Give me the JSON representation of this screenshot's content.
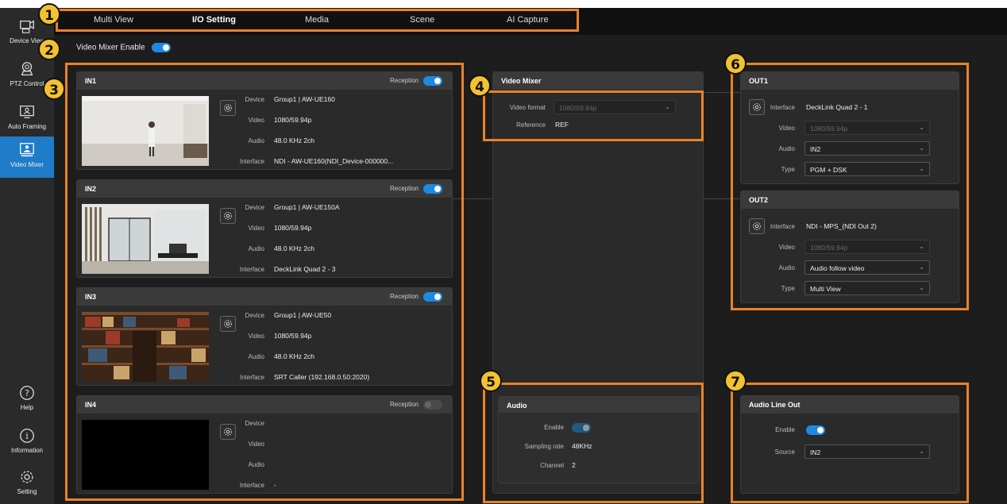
{
  "tabs": [
    {
      "label": "Multi View",
      "active": false
    },
    {
      "label": "I/O Setting",
      "active": true
    },
    {
      "label": "Media",
      "active": false
    },
    {
      "label": "Scene",
      "active": false
    },
    {
      "label": "AI Capture",
      "active": false
    }
  ],
  "sidebar": {
    "items": [
      {
        "label": "Device View",
        "icon": "device-view-icon",
        "active": false
      },
      {
        "label": "PTZ Control",
        "icon": "camera-icon",
        "active": false
      },
      {
        "label": "Auto Framing",
        "icon": "framing-icon",
        "active": false
      },
      {
        "label": "Video Mixer",
        "icon": "video-mixer-icon",
        "active": true
      }
    ],
    "bottom": [
      {
        "label": "Help",
        "icon": "help-icon"
      },
      {
        "label": "Information",
        "icon": "info-icon"
      },
      {
        "label": "Setting",
        "icon": "gear-icon"
      }
    ]
  },
  "mixer_enable_label": "Video Mixer Enable",
  "inputs": [
    {
      "title": "IN1",
      "reception_label": "Reception",
      "reception": true,
      "device": "Group1 | AW-UE160",
      "video": "1080/59.94p",
      "audio": "48.0 KHz 2ch",
      "interface": "NDI - AW-UE160(NDI_Device-000000..."
    },
    {
      "title": "IN2",
      "reception_label": "Reception",
      "reception": true,
      "device": "Group1 | AW-UE150A",
      "video": "1080/59.94p",
      "audio": "48.0 KHz 2ch",
      "interface": "DeckLink Quad 2 - 3"
    },
    {
      "title": "IN3",
      "reception_label": "Reception",
      "reception": true,
      "device": "Group1 | AW-UE50",
      "video": "1080/59.94p",
      "audio": "48.0 KHz 2ch",
      "interface": "SRT Caller (192.168.0.50:2020)"
    },
    {
      "title": "IN4",
      "reception_label": "Reception",
      "reception": false,
      "device": "",
      "video": "",
      "audio": "",
      "interface": "-"
    }
  ],
  "field_labels": {
    "device": "Device",
    "video": "Video",
    "audio": "Audio",
    "interface": "Interface",
    "type": "Type"
  },
  "video_mixer": {
    "title": "Video Mixer",
    "format_label": "Video format",
    "format_value": "1080/59.94p",
    "reference_label": "Reference",
    "reference_value": "REF"
  },
  "audio": {
    "title": "Audio",
    "enable_label": "Enable",
    "sampling_label": "Sampling rate",
    "sampling_value": "48KHz",
    "channel_label": "Channel",
    "channel_value": "2"
  },
  "outputs": [
    {
      "title": "OUT1",
      "interface": "DeckLink Quad 2 - 1",
      "video": "1080/59.94p",
      "audio": "IN2",
      "type": "PGM + DSK"
    },
    {
      "title": "OUT2",
      "interface": "NDI - MPS_(NDI Out 2)",
      "video": "1080/59.94p",
      "audio": "Audio follow video",
      "type": "Multi View"
    }
  ],
  "audio_line_out": {
    "title": "Audio Line Out",
    "enable_label": "Enable",
    "source_label": "Source",
    "source_value": "IN2"
  },
  "callouts": [
    "1",
    "2",
    "3",
    "4",
    "5",
    "6",
    "7"
  ],
  "colors": {
    "accent": "#1e88e5",
    "callout": "#e8832a",
    "badge": "#f2c230",
    "active_sidebar": "#1e7cc8"
  }
}
